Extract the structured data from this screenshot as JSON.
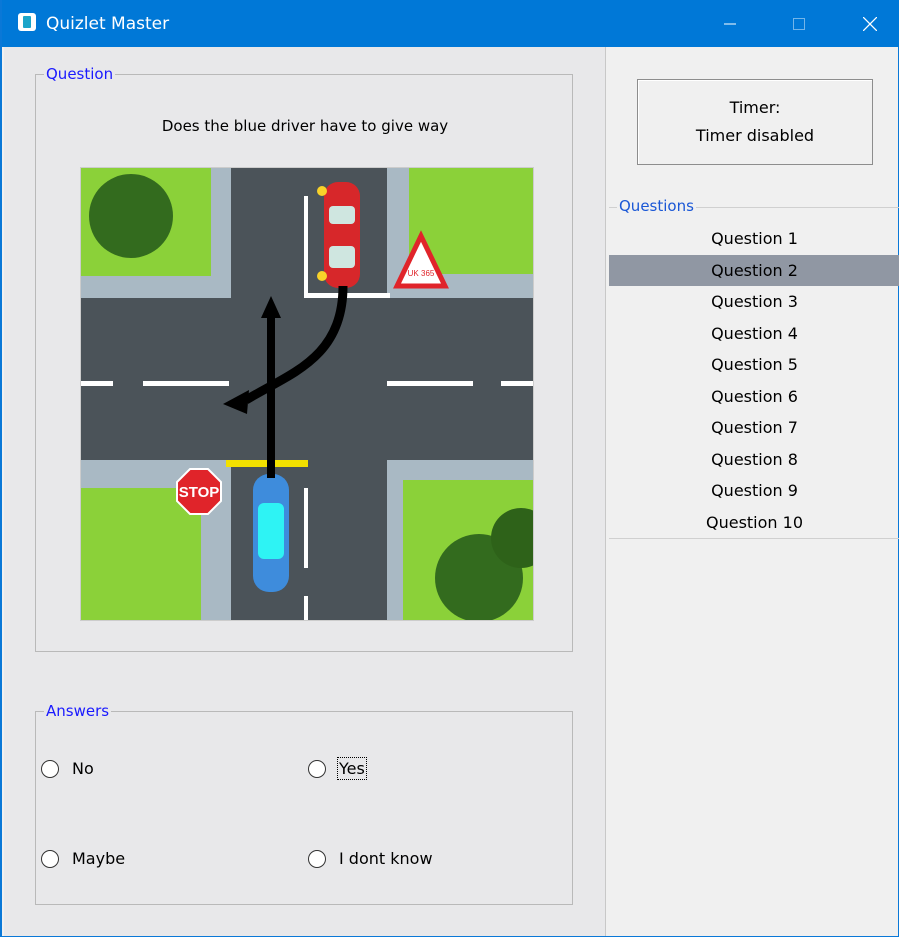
{
  "window": {
    "title": "Quizlet Master"
  },
  "question": {
    "group_label": "Question",
    "text": "Does the blue driver have to give way",
    "image_signs": {
      "stop": "STOP",
      "warning": "UK 365"
    }
  },
  "answers": {
    "group_label": "Answers",
    "options": [
      "No",
      "Yes",
      "Maybe",
      "I dont know"
    ]
  },
  "timer": {
    "label": "Timer:",
    "value": "Timer disabled"
  },
  "questions": {
    "group_label": "Questions",
    "items": [
      "Question 1",
      "Question 2",
      "Question 3",
      "Question 4",
      "Question 5",
      "Question 6",
      "Question 7",
      "Question 8",
      "Question 9",
      "Question 10"
    ],
    "selected_index": 1
  },
  "colors": {
    "titlebar": "#0078d7",
    "group_label": "#1a1aff",
    "selected_row": "#9097a3"
  }
}
